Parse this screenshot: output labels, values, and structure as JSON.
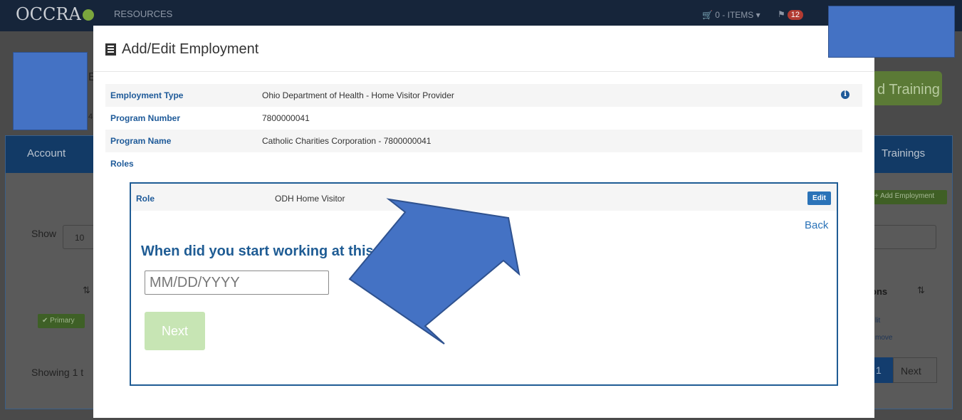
{
  "app": {
    "logo": "OCCRA",
    "nav_resources": "RESOURCES",
    "cart": "0 - ITEMS",
    "flag_count": "12"
  },
  "background": {
    "account_tab": "Account",
    "trainings_tab": "Trainings",
    "training_button": "d Training",
    "add_employment": "+ Add Employment",
    "show_label": "Show",
    "show_value": "10",
    "actions_header": "ons",
    "primary_badge": "Primary",
    "edit_link": "lit",
    "remove_link": "move",
    "showing_text": "Showing 1 t",
    "page_current": "1",
    "next_button": "Next",
    "fragment_e": "E",
    "fragment_4": "4"
  },
  "modal": {
    "title": "Add/Edit Employment",
    "details": [
      {
        "label": "Employment Type",
        "value": "Ohio Department of Health - Home Visitor Provider"
      },
      {
        "label": "Program Number",
        "value": "7800000041"
      },
      {
        "label": "Program Name",
        "value": "Catholic Charities Corporation - 7800000041"
      }
    ],
    "roles_label": "Roles",
    "role": {
      "label": "Role",
      "value": "ODH Home Visitor",
      "edit_button": "Edit"
    },
    "back_link": "Back",
    "question": "When did you start working at this",
    "date_placeholder": "MM/DD/YYYY",
    "next_button": "Next"
  },
  "colors": {
    "accent_blue": "#1f5c94",
    "edit_button": "#2b73b8",
    "next_disabled": "#c7e5b4",
    "annotation_arrow": "#4472c4"
  }
}
